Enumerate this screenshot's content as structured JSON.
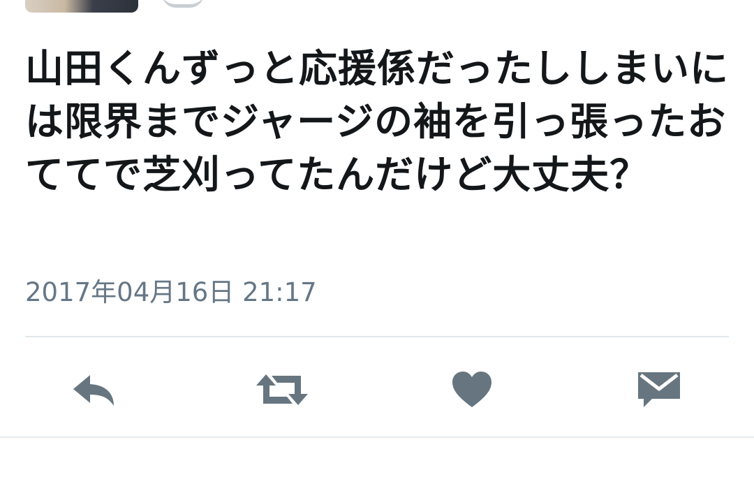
{
  "tweet": {
    "text": "山田くんずっと応援係だったししまいには限界までジャージの袖を引っ張ったおててで芝刈ってたんだけど大丈夫？",
    "timestamp": "2017年04月16日 21:17"
  },
  "actions": {
    "reply_icon": "reply-icon",
    "retweet_icon": "retweet-icon",
    "like_icon": "heart-icon",
    "dm_icon": "envelope-icon"
  },
  "colors": {
    "text": "#14171a",
    "secondary": "#657786",
    "icon": "#66757f",
    "divider": "#e1e8ed"
  }
}
